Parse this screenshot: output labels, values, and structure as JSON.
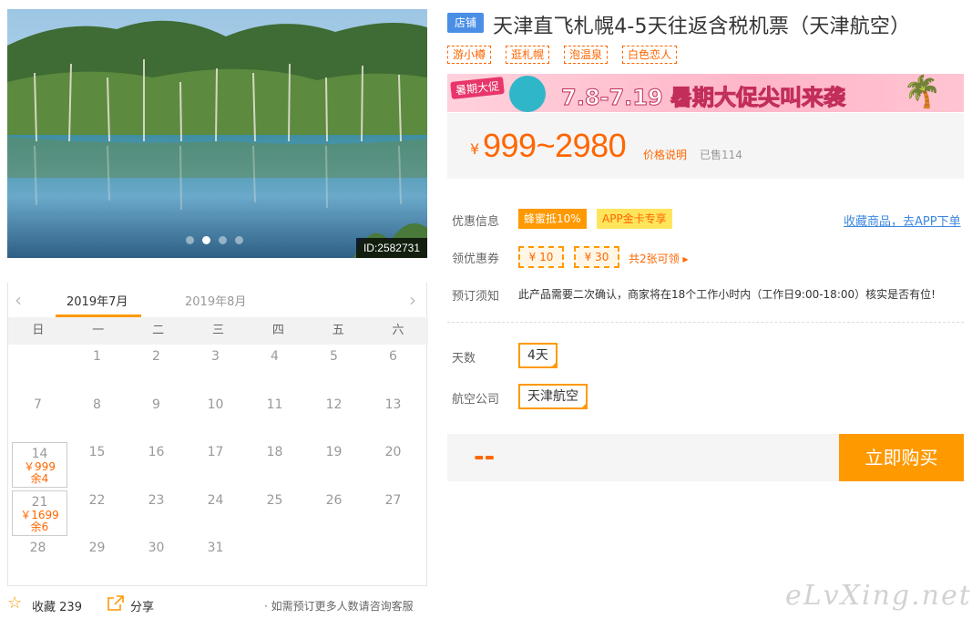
{
  "gallery": {
    "photo_id": "ID:2582731",
    "dots": 4,
    "active_dot": 1
  },
  "calendar": {
    "months": [
      "2019年7月",
      "2019年8月"
    ],
    "weekdays": [
      "日",
      "一",
      "二",
      "三",
      "四",
      "五",
      "六"
    ],
    "leading_blanks": 1,
    "days": [
      {
        "d": "1"
      },
      {
        "d": "2"
      },
      {
        "d": "3"
      },
      {
        "d": "4"
      },
      {
        "d": "5"
      },
      {
        "d": "6"
      },
      {
        "d": "7"
      },
      {
        "d": "8"
      },
      {
        "d": "9"
      },
      {
        "d": "10"
      },
      {
        "d": "11"
      },
      {
        "d": "12"
      },
      {
        "d": "13"
      },
      {
        "d": "14",
        "price": "￥999",
        "remain": "余4"
      },
      {
        "d": "15"
      },
      {
        "d": "16"
      },
      {
        "d": "17"
      },
      {
        "d": "18"
      },
      {
        "d": "19"
      },
      {
        "d": "20"
      },
      {
        "d": "21",
        "price": "￥1699",
        "remain": "余6"
      },
      {
        "d": "22"
      },
      {
        "d": "23"
      },
      {
        "d": "24"
      },
      {
        "d": "25"
      },
      {
        "d": "26"
      },
      {
        "d": "27"
      },
      {
        "d": "28"
      },
      {
        "d": "29"
      },
      {
        "d": "30"
      },
      {
        "d": "31"
      }
    ]
  },
  "actions": {
    "favorite_label": "收藏",
    "favorite_count": "239",
    "share_label": "分享",
    "notice": "· 如需预订更多人数请咨询客服"
  },
  "product": {
    "shop_badge": "店铺",
    "title": "天津直飞札幌4-5天往返含税机票（天津航空）",
    "tags": [
      "游小樽",
      "逛札幌",
      "泡温泉",
      "白色恋人"
    ]
  },
  "banner": {
    "badge": "暑期大促",
    "text": "7.8-7.19 暑期大促尖叫来袭"
  },
  "price": {
    "symbol": "¥",
    "range": "999~2980",
    "explain": "价格说明",
    "sold": "已售114"
  },
  "promo": {
    "label": "优惠信息",
    "honey": "蜂蜜抵10%",
    "app_card": "APP金卡专享",
    "fav_link": "收藏商品，去APP下单"
  },
  "coupons": {
    "label": "领优惠券",
    "items": [
      "¥ 10",
      "¥ 30"
    ],
    "more": "共2张可领"
  },
  "booking": {
    "label": "预订须知",
    "text": "此产品需要二次确认，商家将在18个工作小时内（工作日9:00-18:00）核实是否有位!"
  },
  "options": {
    "days_label": "天数",
    "days_value": "4天",
    "airline_label": "航空公司",
    "airline_value": "天津航空"
  },
  "buy": {
    "total": "--",
    "button": "立即购买"
  },
  "watermark": "eLvXing.net",
  "colors": {
    "accent": "#ff9900",
    "price": "#ff6600",
    "badge": "#4a8ee6"
  }
}
